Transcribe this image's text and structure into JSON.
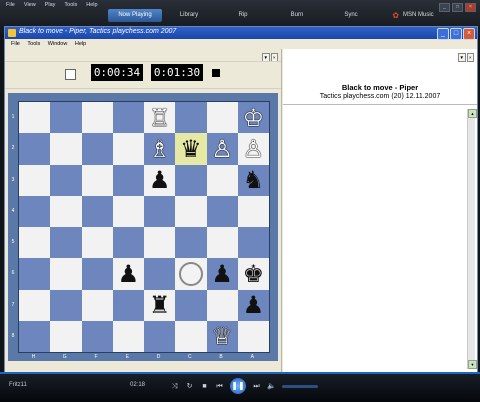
{
  "player": {
    "menu": [
      "File",
      "View",
      "Play",
      "Tools",
      "Help"
    ],
    "tabs": [
      "Now Playing",
      "Library",
      "Rip",
      "Burn",
      "Sync",
      "MSN Music"
    ],
    "active_tab": "Now Playing"
  },
  "window": {
    "title": "Black to move - Piper, Tactics playchess.com 2007",
    "menu": [
      "File",
      "Tools",
      "Window",
      "Help"
    ]
  },
  "clocks": {
    "white_time": "0:00:34",
    "black_time": "0:01:30"
  },
  "board": {
    "ranks": [
      "1",
      "2",
      "3",
      "4",
      "5",
      "6",
      "7",
      "8"
    ],
    "files": [
      "H",
      "G",
      "F",
      "E",
      "D",
      "C",
      "B",
      "A"
    ],
    "highlight_square": [
      1,
      5
    ],
    "empty_ring_square": [
      5,
      5
    ],
    "squares": [
      [
        "",
        "",
        "",
        "",
        "♖",
        "",
        "",
        "♔"
      ],
      [
        "",
        "",
        "",
        "",
        "♗",
        "♛",
        "♙",
        "♙"
      ],
      [
        "",
        "",
        "",
        "",
        "♟",
        "",
        "",
        "♞"
      ],
      [
        "",
        "",
        "",
        "",
        "",
        "",
        "",
        ""
      ],
      [
        "",
        "",
        "",
        "",
        "",
        "",
        "",
        ""
      ],
      [
        "",
        "",
        "",
        "♟",
        "",
        "",
        "♟",
        "♚"
      ],
      [
        "",
        "",
        "",
        "",
        "♜",
        "",
        "",
        "♟"
      ],
      [
        "",
        "",
        "",
        "",
        "",
        "",
        "♕",
        ""
      ]
    ]
  },
  "puzzle": {
    "title": "Black to move - Piper",
    "subtitle": "Tactics playchess.com (20) 12.11.2007"
  },
  "transport": {
    "status_text": "Fritz11",
    "elapsed": "02:18"
  }
}
